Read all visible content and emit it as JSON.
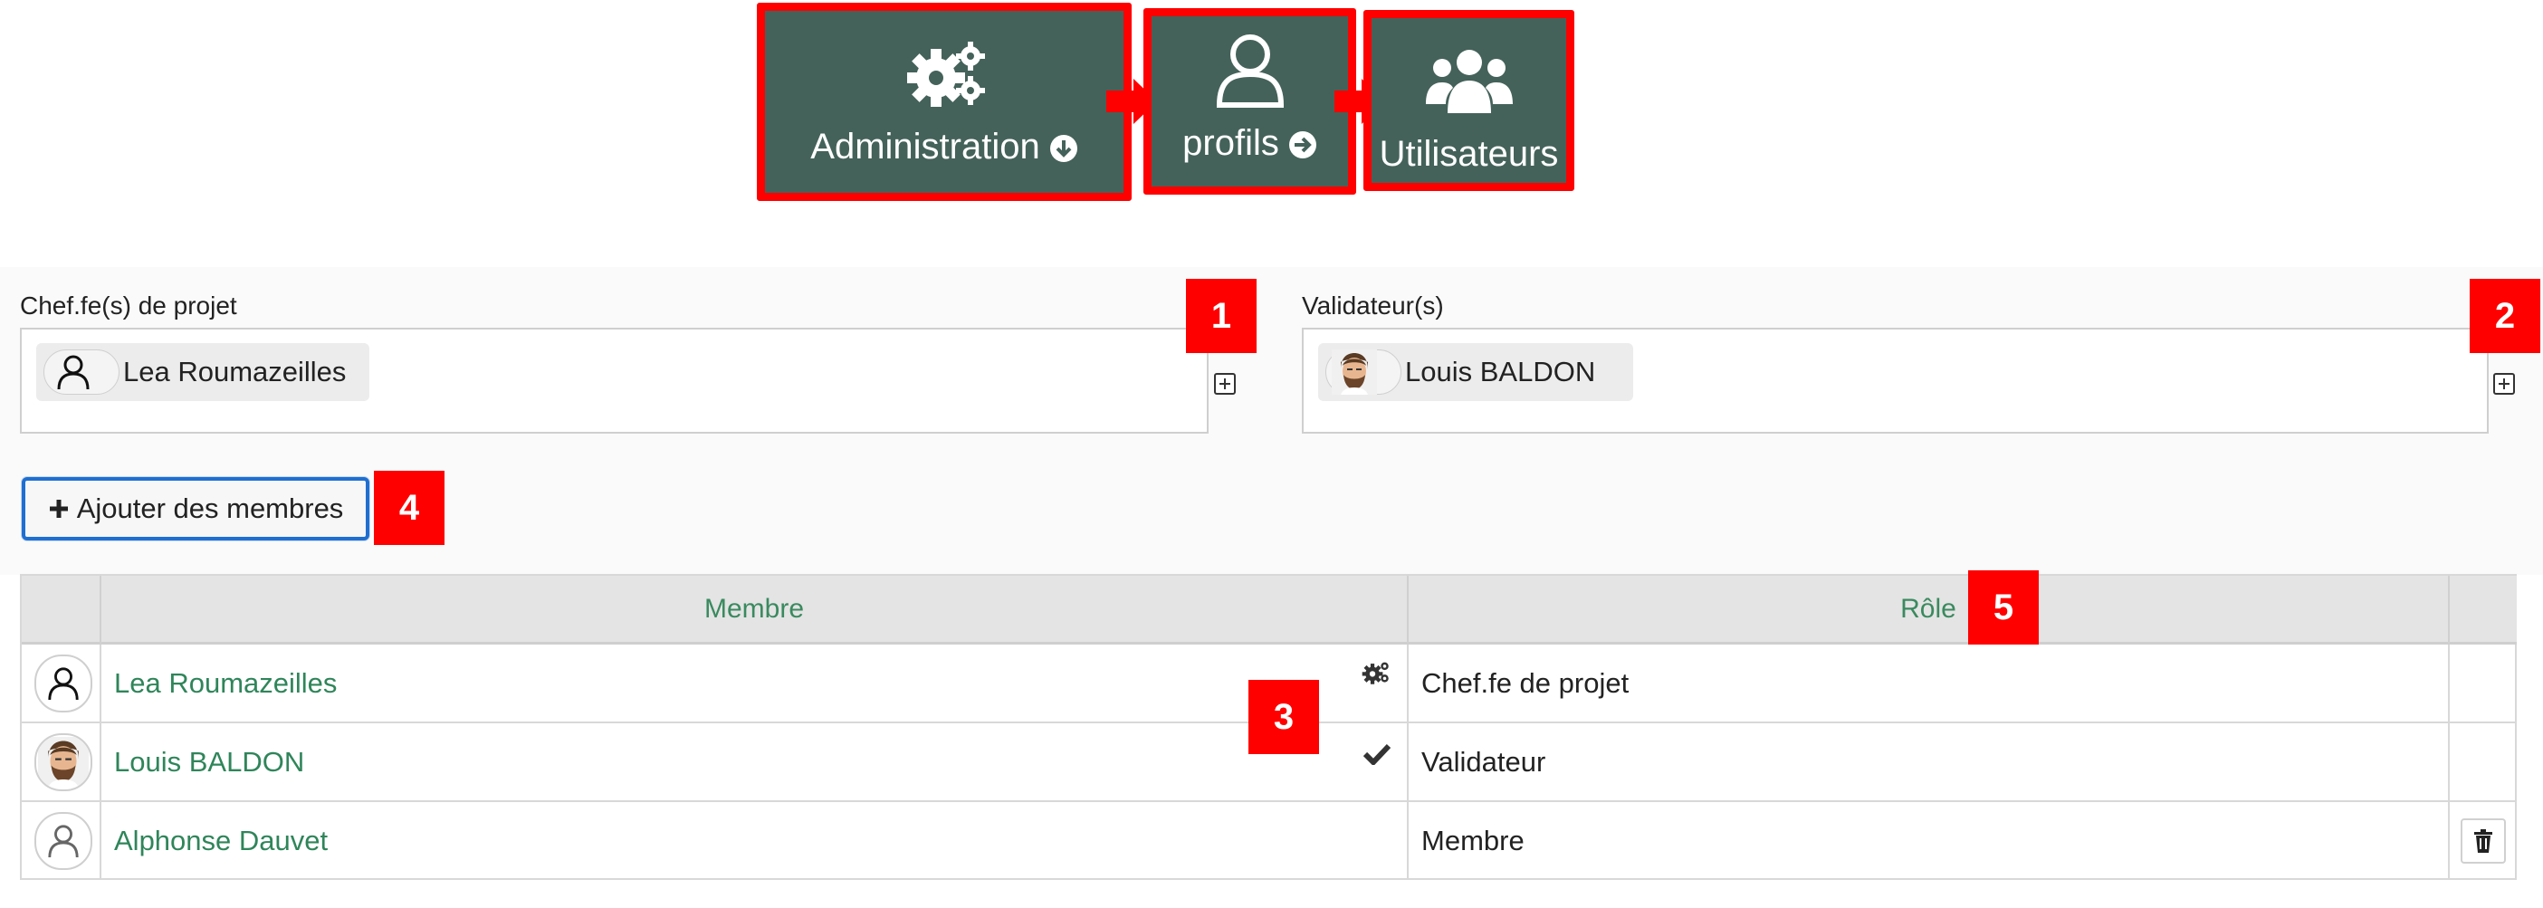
{
  "nav": {
    "administration_label": "Administration",
    "profils_label": "profils",
    "utilisateurs_label": "Utilisateurs",
    "frame_color": "#ff0000",
    "box_color": "#44625a"
  },
  "form": {
    "chef_label": "Chef.fe(s) de projet",
    "chef_value": "Lea Roumazeilles",
    "validateur_label": "Validateur(s)",
    "validateur_value": "Louis BALDON"
  },
  "markers": {
    "m1": "1",
    "m2": "2",
    "m3": "3",
    "m4": "4",
    "m5": "5"
  },
  "toolbar": {
    "add_members_label": "Ajouter des membres"
  },
  "table": {
    "headers": {
      "member": "Membre",
      "role": "Rôle"
    },
    "rows": [
      {
        "member": "Lea Roumazeilles",
        "role": "Chef.fe de projet",
        "status_icon": "gears-icon"
      },
      {
        "member": "Louis BALDON",
        "role": "Validateur",
        "status_icon": "check-icon"
      },
      {
        "member": "Alphonse Dauvet",
        "role": "Membre",
        "action_icon": "trash-icon"
      }
    ]
  },
  "colors": {
    "accent_green": "#2f855a",
    "focus_blue": "#1f6fd1",
    "annotation_red": "#ff0000"
  }
}
